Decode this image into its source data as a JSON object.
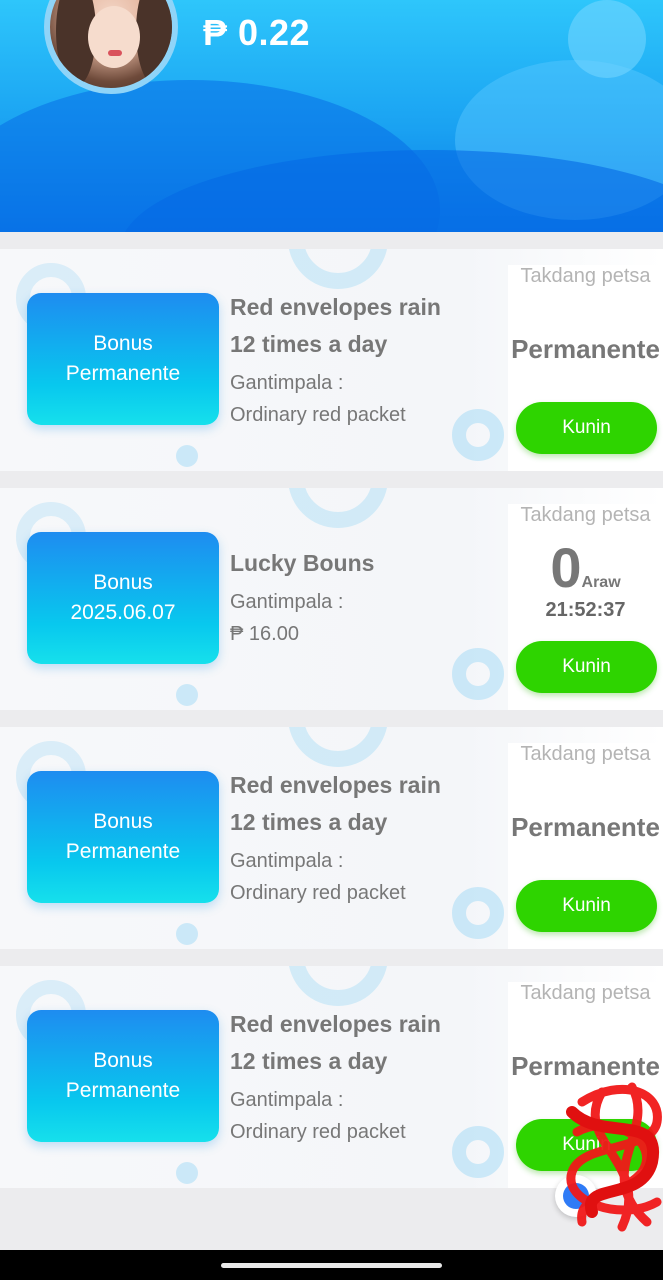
{
  "header": {
    "balance": "₱ 0.22"
  },
  "cards": [
    {
      "badge_line1": "Bonus",
      "badge_line2": "Permanente",
      "title_line1": "Red envelopes rain",
      "title_line2": "12 times a day",
      "reward_label": "Gantimpala :",
      "reward_value": "Ordinary red packet",
      "deadline_label": "Takdang petsa",
      "deadline_value": "Permanente",
      "button_label": "Kunin"
    },
    {
      "badge_line1": "Bonus",
      "badge_line2": "2025.06.07",
      "title_line1": "Lucky Bouns",
      "title_line2": "",
      "reward_label": "Gantimpala :",
      "reward_value": "₱ 16.00",
      "deadline_label": "Takdang petsa",
      "countdown_days": "0",
      "countdown_unit": "Araw",
      "countdown_time": "21:52:37",
      "button_label": "Kunin"
    },
    {
      "badge_line1": "Bonus",
      "badge_line2": "Permanente",
      "title_line1": "Red envelopes rain",
      "title_line2": "12 times a day",
      "reward_label": "Gantimpala :",
      "reward_value": "Ordinary red packet",
      "deadline_label": "Takdang petsa",
      "deadline_value": "Permanente",
      "button_label": "Kunin"
    },
    {
      "badge_line1": "Bonus",
      "badge_line2": "Permanente",
      "title_line1": "Red envelopes rain",
      "title_line2": "12 times a day",
      "reward_label": "Gantimpala :",
      "reward_value": "Ordinary red packet",
      "deadline_label": "Takdang petsa",
      "deadline_value": "Permanente",
      "button_label": "Kunin"
    }
  ],
  "colors": {
    "header_blue": "#1aa2f2",
    "badge_gradient_top": "#1e8cf0",
    "badge_gradient_bottom": "#16e0ec",
    "button_green": "#2ed400",
    "text_gray": "#777777"
  },
  "icons": {
    "avatar": "user-avatar-photo",
    "floating_button": "messenger-icon"
  }
}
